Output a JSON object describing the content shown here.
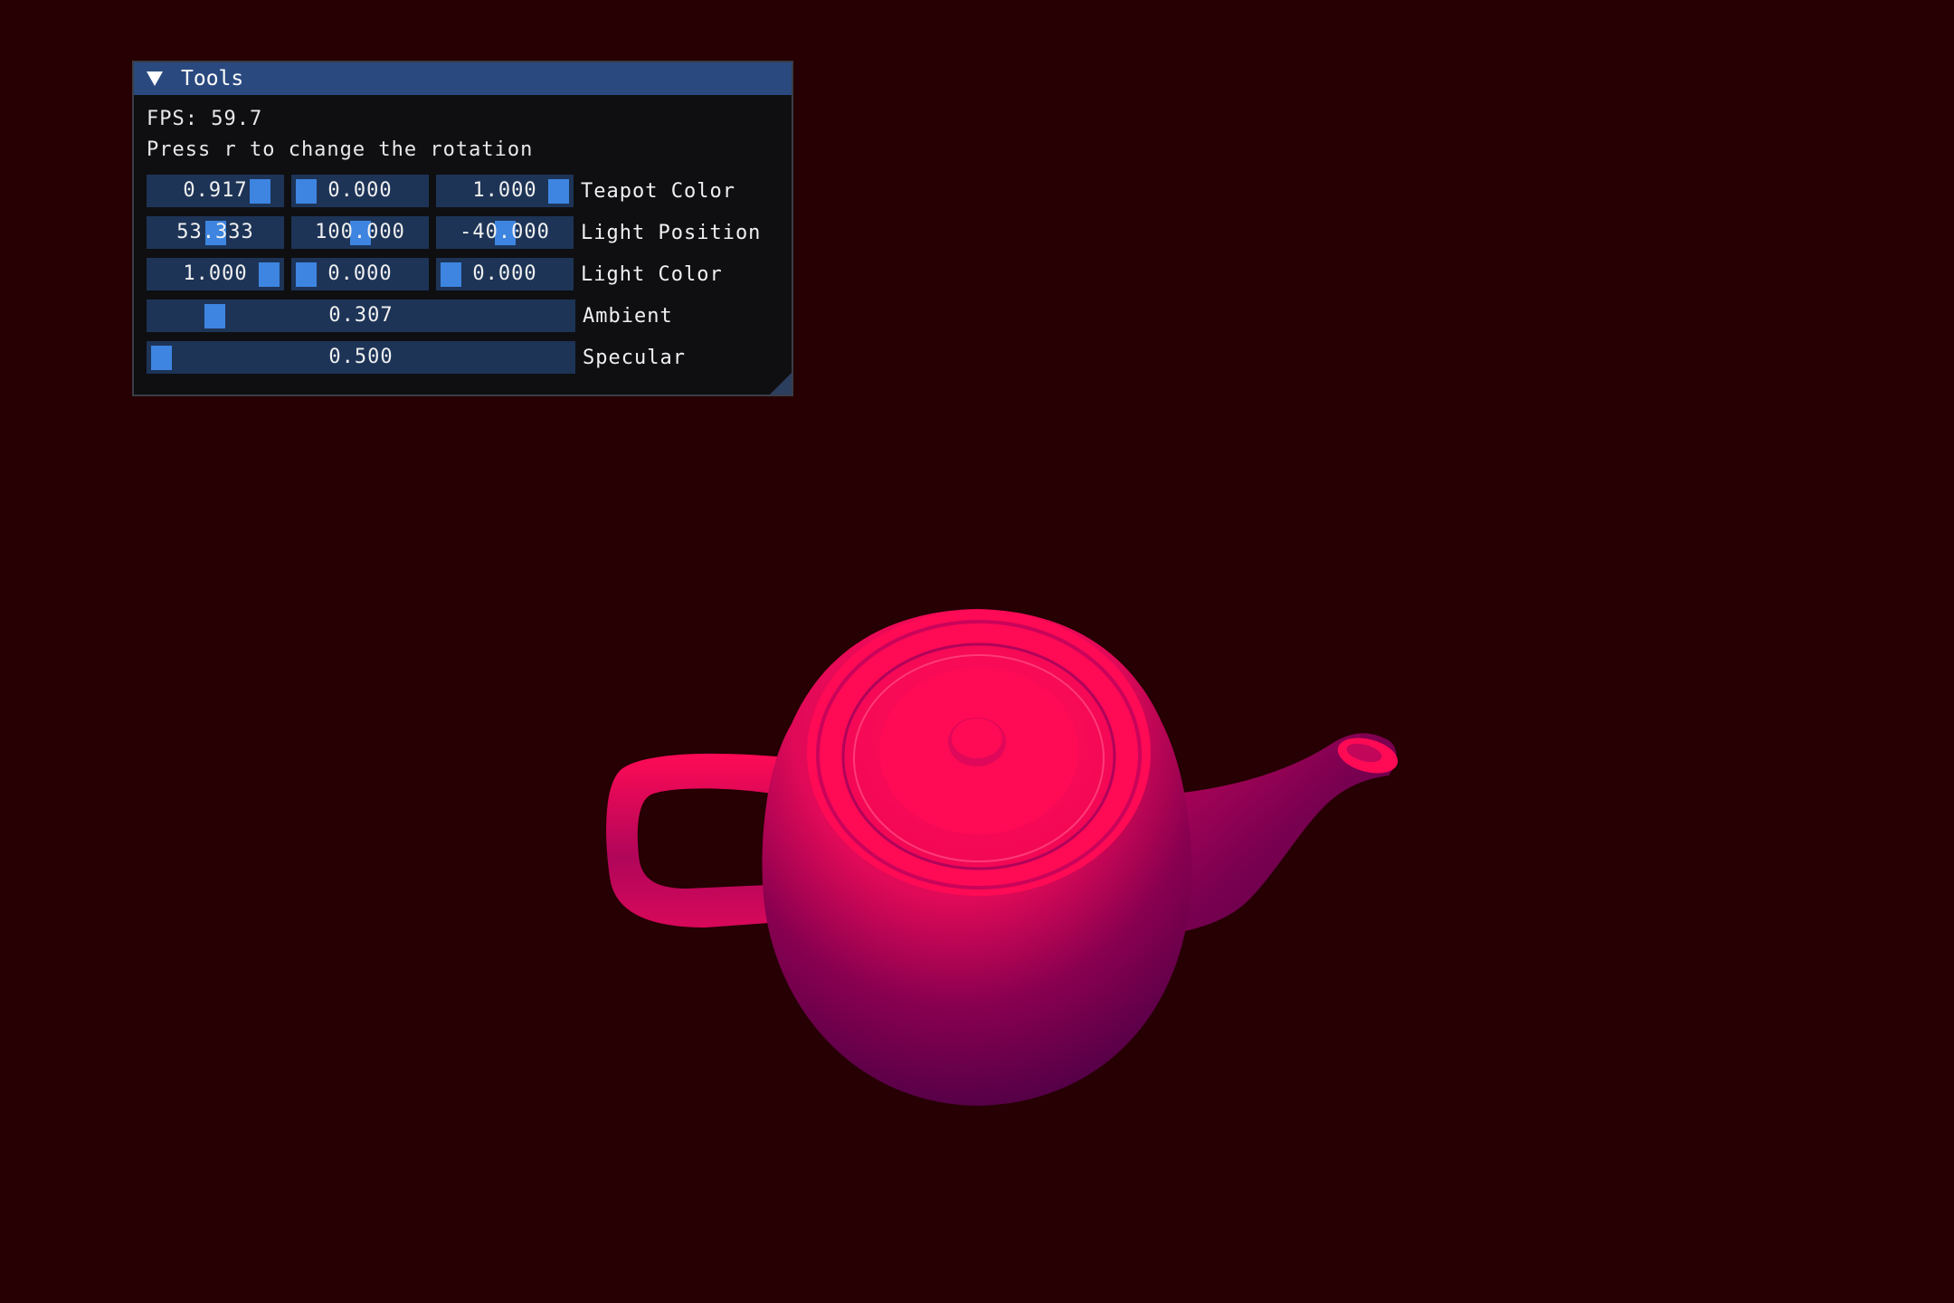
{
  "window": {
    "title": "Tools",
    "fps_text": "FPS: 59.7",
    "hint_text": "Press r to change the rotation"
  },
  "controls": {
    "teapot_color": {
      "label": "Teapot Color",
      "values": [
        "0.917",
        "0.000",
        "1.000"
      ],
      "fractions": [
        0.917,
        0.0,
        1.0
      ]
    },
    "light_position": {
      "label": "Light Position",
      "values": [
        "53.333",
        "100.000",
        "-40.000"
      ],
      "fractions": [
        0.5,
        0.5,
        0.5
      ]
    },
    "light_color": {
      "label": "Light Color",
      "values": [
        "1.000",
        "0.000",
        "0.000"
      ],
      "fractions": [
        1.0,
        0.0,
        0.0
      ]
    },
    "ambient": {
      "label": "Ambient",
      "value": "0.307",
      "fraction": 0.134
    },
    "specular": {
      "label": "Specular",
      "value": "0.500",
      "fraction": 0.0
    }
  },
  "colors": {
    "background": "#260003",
    "teapot_lit": "#ff0a55",
    "teapot_shadow": "#4a0046",
    "title_bar": "#2a4a7f",
    "slider_bg": "#1d3457",
    "slider_grab": "#3d85e0"
  },
  "icons": {
    "collapse": "triangle-down-icon"
  }
}
